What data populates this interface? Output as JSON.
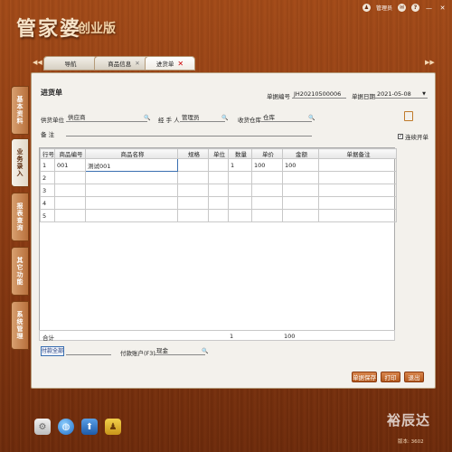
{
  "app": {
    "brand_main": "管家婆",
    "brand_sub": "创业版",
    "user": "管理员",
    "version": "版本: 3602"
  },
  "tabs": [
    {
      "label": "导航"
    },
    {
      "label": "商品信息"
    },
    {
      "label": "进货单",
      "active": true
    }
  ],
  "left_nav": [
    {
      "label": "基本资料"
    },
    {
      "label": "业务录入",
      "active": true
    },
    {
      "label": "报表查询"
    },
    {
      "label": "其它功能"
    },
    {
      "label": "系统管理"
    }
  ],
  "form": {
    "title": "进货单",
    "doc_no_label": "单据编号",
    "doc_no": "JH20210500006",
    "doc_date_label": "单据日期",
    "doc_date": "2021-05-08",
    "supplier_label": "供货单位",
    "supplier": "供应商",
    "handler_label": "经 手 人",
    "handler": "管理员",
    "warehouse_label": "收货仓库",
    "warehouse": "仓库",
    "remark_label": "备    注",
    "remark": "",
    "continuous_label": "连续开单",
    "continuous_checked": true
  },
  "table": {
    "headers": [
      "行号",
      "商品编号",
      "商品名称",
      "规格",
      "单位",
      "数量",
      "单价",
      "金额",
      "单据备注"
    ],
    "rows": [
      [
        "1",
        "001",
        "测试001",
        "",
        "",
        "1",
        "100",
        "100",
        ""
      ],
      [
        "2",
        "",
        "",
        "",
        "",
        "",
        "",
        "",
        ""
      ],
      [
        "3",
        "",
        "",
        "",
        "",
        "",
        "",
        "",
        ""
      ],
      [
        "4",
        "",
        "",
        "",
        "",
        "",
        "",
        "",
        ""
      ],
      [
        "5",
        "",
        "",
        "",
        "",
        "",
        "",
        "",
        ""
      ]
    ],
    "total_label": "合计",
    "total_qty": "1",
    "total_amount": "100"
  },
  "payment": {
    "pay_all_label": "付款全部",
    "account_label": "付款账户(F3)",
    "account": "现金"
  },
  "actions": {
    "save": "单据保存",
    "print": "打印",
    "exit": "退出"
  },
  "watermark": "裕辰达"
}
